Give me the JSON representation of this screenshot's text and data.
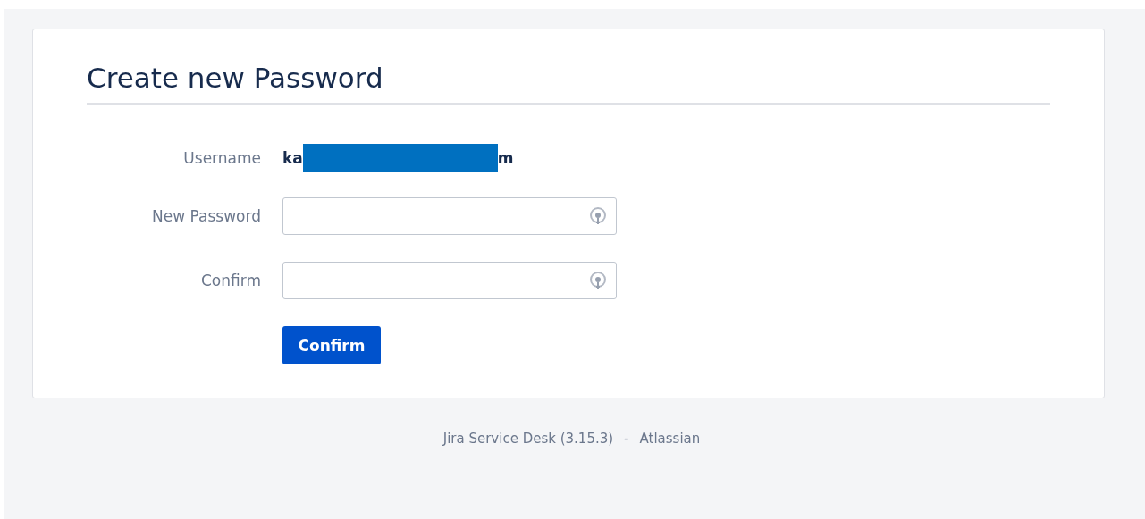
{
  "title": "Create new Password",
  "username": {
    "label": "Username",
    "value_start": "ka",
    "value_end": "m",
    "redacted": true
  },
  "fields": [
    {
      "label": "New Password"
    },
    {
      "label": "Confirm"
    }
  ],
  "submit": {
    "label": "Confirm"
  },
  "footer": {
    "product": "Jira Service Desk (3.15.3)",
    "separator": "-",
    "company": "Atlassian"
  }
}
